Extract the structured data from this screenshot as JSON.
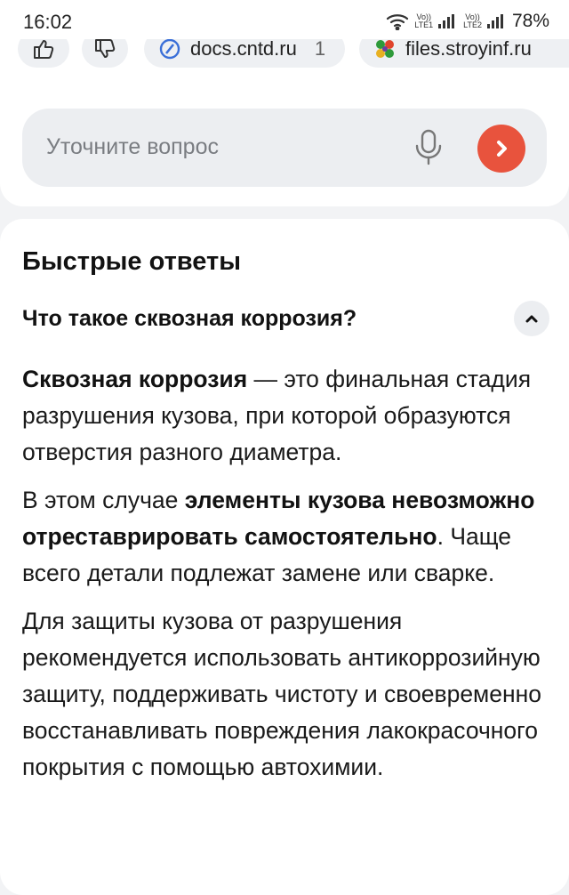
{
  "status_bar": {
    "time": "16:02",
    "sim1_top": "Vo))",
    "sim1_bottom": "LTE1",
    "sim2_top": "Vo))",
    "sim2_bottom": "LTE2",
    "battery": "78%"
  },
  "sources": [
    {
      "domain": "docs.cntd.ru",
      "count": "1"
    },
    {
      "domain": "files.stroyinf.ru"
    }
  ],
  "ask": {
    "placeholder": "Уточните вопрос"
  },
  "answers": {
    "title": "Быстрые ответы",
    "question": "Что такое сквозная коррозия?",
    "p1_bold": "Сквозная коррозия",
    "p1_rest": " — это финальная стадия разрушения кузова, при которой образуются отверстия разного диаметра.",
    "p2_start": "В этом случае ",
    "p2_bold": "элементы кузова невозможно отреставрировать самостоятельно",
    "p2_end": ". Чаще всего детали подлежат замене или сварке.",
    "p3": "Для защиты кузова от разрушения рекомендуется использовать антикоррозийную защиту, поддерживать чистоту и своевременно восстанавливать повреждения лакокрасочного покрытия с помощью автохимии."
  },
  "colors": {
    "accent": "#e8533d",
    "chip_bg": "#eef0f3",
    "page_bg": "#f2f3f5"
  }
}
